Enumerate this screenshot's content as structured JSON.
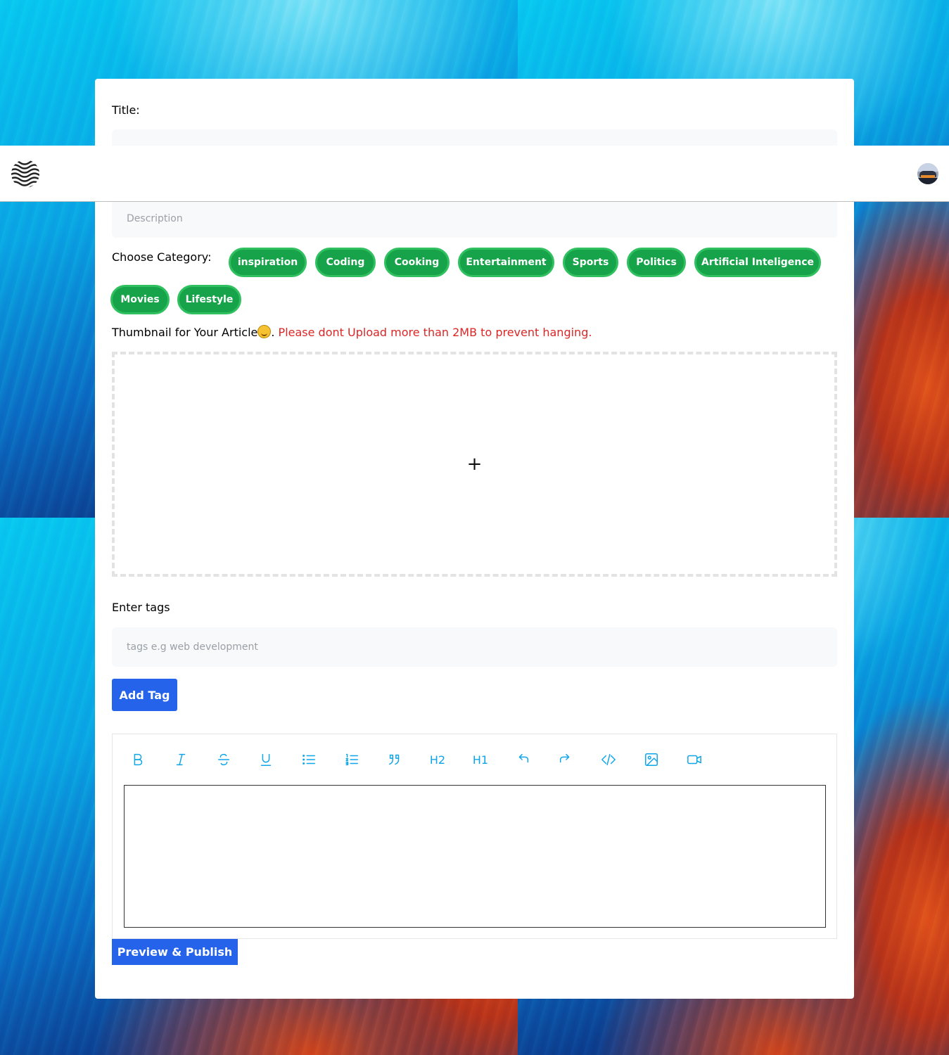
{
  "form": {
    "title_label": "Title:",
    "description_placeholder": "Description",
    "category_label": "Choose Category:",
    "categories": [
      "inspiration",
      "Coding",
      "Cooking",
      "Entertainment",
      "Sports",
      "Politics",
      "Artificial Inteligence",
      "Movies",
      "Lifestyle"
    ],
    "thumbnail_label": "Thumbnail for Your Article",
    "thumbnail_separator": ". ",
    "thumbnail_warning": "Please dont Upload more than 2MB to prevent hanging.",
    "upload_plus": "+",
    "tags_label": "Enter tags",
    "tags_placeholder": "tags e.g web development",
    "add_tag_button": "Add Tag",
    "publish_button": "Preview & Publish"
  },
  "editor": {
    "toolbar": [
      "bold-icon",
      "italic-icon",
      "strikethrough-icon",
      "underline-icon",
      "bullet-list-icon",
      "ordered-list-icon",
      "blockquote-icon",
      "H2",
      "H1",
      "undo-icon",
      "redo-icon",
      "code-icon",
      "image-icon",
      "video-icon"
    ],
    "heading2_label": "H2",
    "heading1_label": "H1"
  },
  "colors": {
    "chip_green": "#16a34a",
    "primary_blue": "#2563eb",
    "warning_red": "#dc2626",
    "toolbar_icon": "#0ea5e9"
  }
}
